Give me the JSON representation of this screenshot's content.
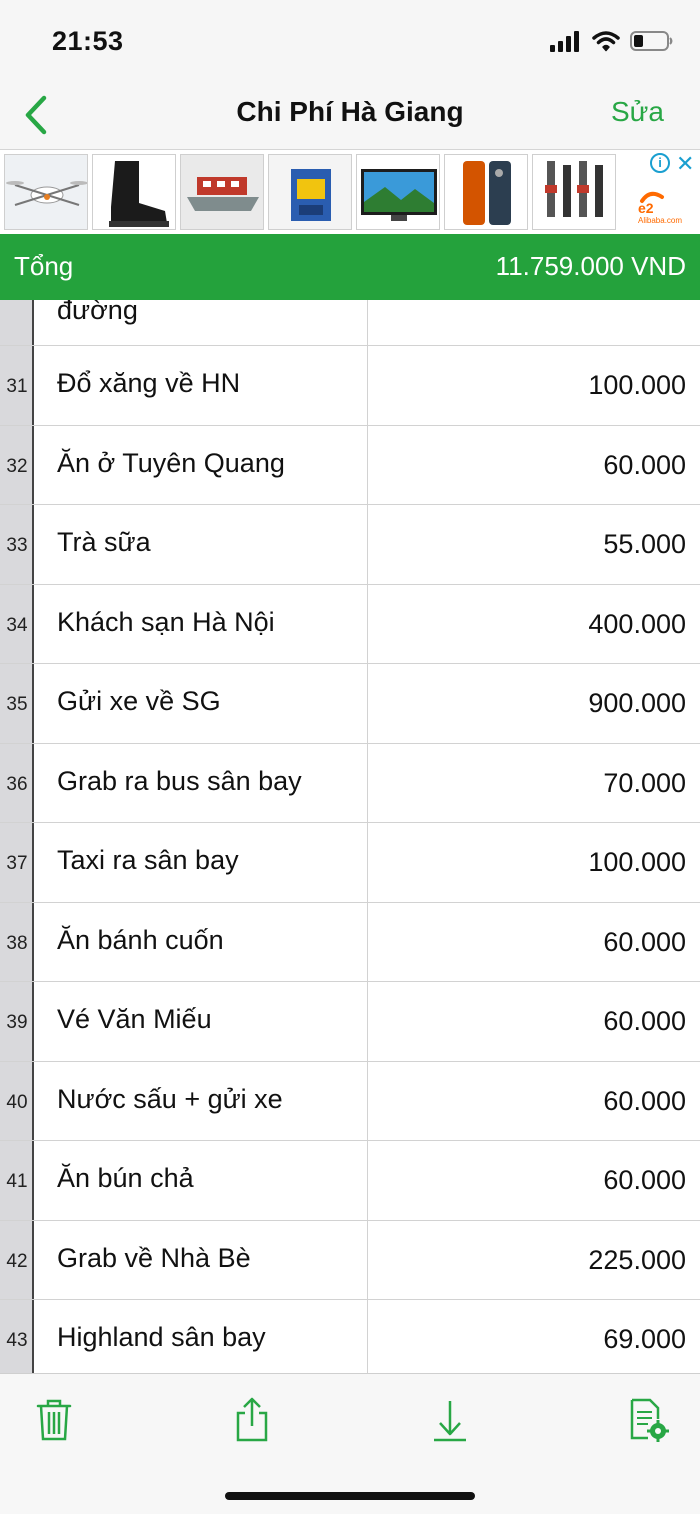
{
  "status_bar": {
    "time": "21:53",
    "icons": [
      "cellular-signal-icon",
      "wifi-icon",
      "battery-icon"
    ]
  },
  "nav": {
    "back_icon": "chevron-left-icon",
    "title": "Chi Phí Hà Giang",
    "edit_label": "Sửa"
  },
  "ad_banner": {
    "items": [
      "drone-icon",
      "boot-icon",
      "boat-icon",
      "machine-icon",
      "tv-icon",
      "phone-case-icon",
      "shock-absorber-icon"
    ],
    "info_label": "i",
    "close_label": "✕",
    "brand_name": "Alibaba.com"
  },
  "total": {
    "label": "Tổng",
    "value": "11.759.000 VND"
  },
  "sheet": {
    "partial_row_text": "đường",
    "rows": [
      {
        "num": "31",
        "desc": "Đổ xăng về HN",
        "amount": "100.000"
      },
      {
        "num": "32",
        "desc": "Ăn ở Tuyên Quang",
        "amount": "60.000"
      },
      {
        "num": "33",
        "desc": "Trà sữa",
        "amount": "55.000"
      },
      {
        "num": "34",
        "desc": "Khách sạn Hà Nội",
        "amount": "400.000"
      },
      {
        "num": "35",
        "desc": "Gửi xe về SG",
        "amount": "900.000"
      },
      {
        "num": "36",
        "desc": "Grab ra bus sân bay",
        "amount": "70.000"
      },
      {
        "num": "37",
        "desc": "Taxi ra sân bay",
        "amount": "100.000"
      },
      {
        "num": "38",
        "desc": "Ăn bánh cuốn",
        "amount": "60.000"
      },
      {
        "num": "39",
        "desc": "Vé Văn Miếu",
        "amount": "60.000"
      },
      {
        "num": "40",
        "desc": "Nước sấu + gửi xe",
        "amount": "60.000"
      },
      {
        "num": "41",
        "desc": "Ăn bún chả",
        "amount": "60.000"
      },
      {
        "num": "42",
        "desc": "Grab về Nhà Bè",
        "amount": "225.000"
      },
      {
        "num": "43",
        "desc": "Highland sân bay",
        "amount": "69.000"
      }
    ]
  },
  "toolbar": {
    "buttons": [
      "trash-icon",
      "share-icon",
      "download-icon",
      "document-settings-icon"
    ]
  },
  "colors": {
    "accent_green": "#24a23c",
    "link_green": "#28a745",
    "ad_blue": "#1a9fd0"
  }
}
